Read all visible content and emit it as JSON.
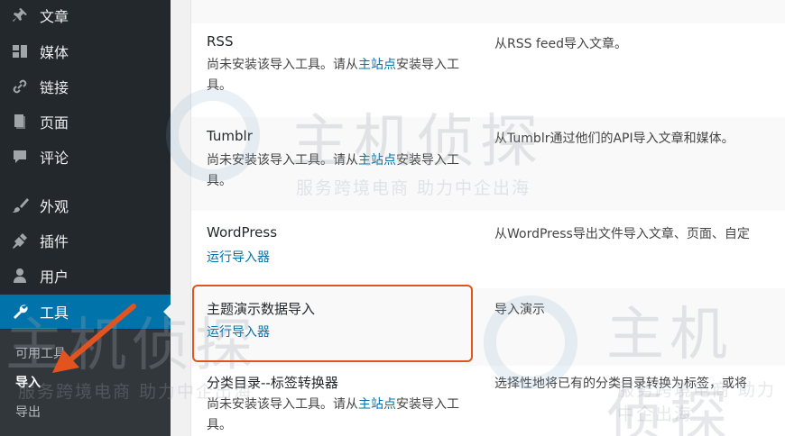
{
  "sidebar": {
    "items": [
      {
        "label": "文章",
        "icon": "pin-icon"
      },
      {
        "label": "媒体",
        "icon": "media-icon"
      },
      {
        "label": "链接",
        "icon": "link-icon"
      },
      {
        "label": "页面",
        "icon": "page-icon"
      },
      {
        "label": "评论",
        "icon": "comment-icon"
      },
      {
        "label": "外观",
        "icon": "brush-icon"
      },
      {
        "label": "插件",
        "icon": "plugin-icon"
      },
      {
        "label": "用户",
        "icon": "user-icon"
      },
      {
        "label": "工具",
        "icon": "wrench-icon"
      }
    ],
    "submenu": [
      "可用工具",
      "导入",
      "导出"
    ]
  },
  "importers": [
    {
      "name": "RSS",
      "note_pre": "尚未安装该导入工具。请从",
      "note_link": "主站点",
      "note_post": "安装导入工具。",
      "desc": "从RSS feed导入文章。"
    },
    {
      "name": "Tumblr",
      "note_pre": "尚未安装该导入工具。请从",
      "note_link": "主站点",
      "note_post": "安装导入工具。",
      "desc": "从Tumblr通过他们的API导入文章和媒体。"
    },
    {
      "name": "WordPress",
      "action": "运行导入器",
      "desc": "从WordPress导出文件导入文章、页面、自定"
    },
    {
      "name": "主题演示数据导入",
      "action": "运行导入器",
      "desc": "导入演示"
    },
    {
      "name": "分类目录--标签转换器",
      "note_pre": "尚未安装该导入工具。请从",
      "note_link": "主站点",
      "note_post": "安装导入工具。",
      "desc": "选择性地将已有的分类目录转换为标签，或将"
    }
  ],
  "watermark": {
    "brand": "主机侦探",
    "slogan": "服务跨境电商 助力中企出海"
  },
  "colors": {
    "accent": "#0073aa",
    "highlight": "#e2541f",
    "sidebar": "#23282d"
  }
}
